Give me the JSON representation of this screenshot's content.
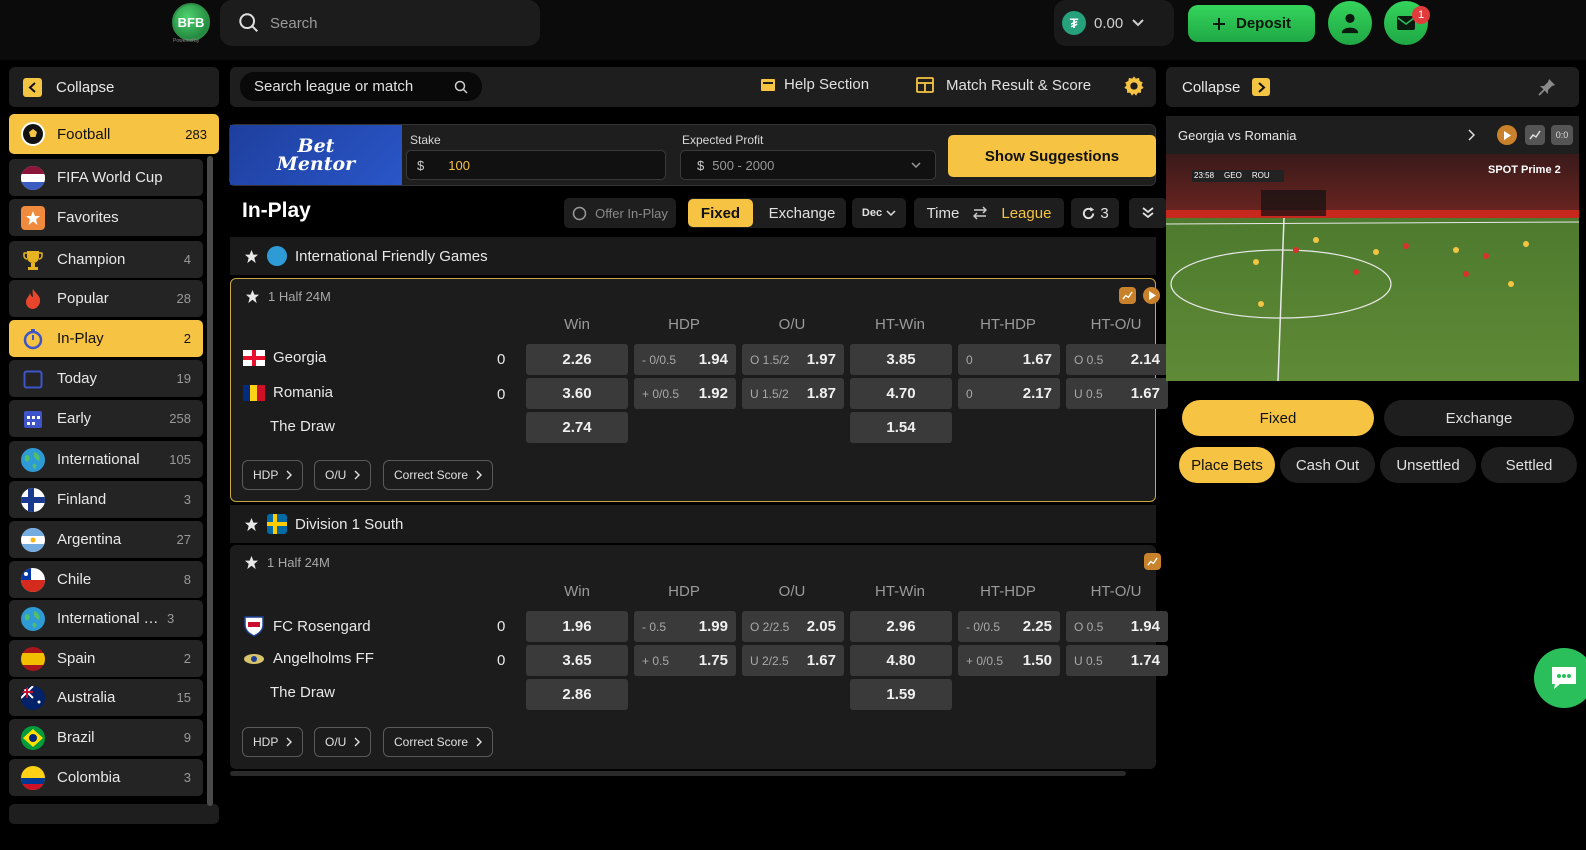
{
  "header": {
    "logo_text": "BFB",
    "logo_sub": "Powered by",
    "search_placeholder": "Search",
    "balance": "0.00",
    "deposit_label": "Deposit",
    "mail_badge": "1"
  },
  "sidebar": {
    "collapse_label": "Collapse",
    "items": [
      {
        "label": "Football",
        "count": "283"
      },
      {
        "label": "FIFA World Cup",
        "count": ""
      },
      {
        "label": "Favorites",
        "count": ""
      },
      {
        "label": "Champion",
        "count": "4"
      },
      {
        "label": "Popular",
        "count": "28"
      },
      {
        "label": "In-Play",
        "count": "2"
      },
      {
        "label": "Today",
        "count": "19"
      },
      {
        "label": "Early",
        "count": "258"
      },
      {
        "label": "International",
        "count": "105"
      },
      {
        "label": "Finland",
        "count": "3"
      },
      {
        "label": "Argentina",
        "count": "27"
      },
      {
        "label": "Chile",
        "count": "8"
      },
      {
        "label": "International Youth",
        "count": "3"
      },
      {
        "label": "Spain",
        "count": "2"
      },
      {
        "label": "Australia",
        "count": "15"
      },
      {
        "label": "Brazil",
        "count": "9"
      },
      {
        "label": "Colombia",
        "count": "3"
      }
    ]
  },
  "toolbar": {
    "league_search_placeholder": "Search league or match",
    "help_label": "Help Section",
    "match_result_label": "Match Result & Score"
  },
  "betmentor": {
    "logo_line1": "Bet",
    "logo_line2": "Mentor",
    "stake_label": "Stake",
    "stake_currency": "$",
    "stake_value": "100",
    "profit_label": "Expected Profit",
    "profit_currency": "$",
    "profit_value": "500 - 2000",
    "suggest_label": "Show Suggestions"
  },
  "inplay": {
    "title": "In-Play",
    "offer_label": "Offer In-Play",
    "fixed_label": "Fixed",
    "exchange_label": "Exchange",
    "odds_format": "Dec",
    "time_label": "Time",
    "league_label": "League",
    "refresh_count": "3"
  },
  "columns": [
    "Win",
    "HDP",
    "O/U",
    "HT-Win",
    "HT-HDP",
    "HT-O/U"
  ],
  "leagues": [
    {
      "name": "International Friendly Games",
      "match": {
        "time": "1 Half 24M",
        "home": {
          "name": "Georgia",
          "score": "0"
        },
        "away": {
          "name": "Romania",
          "score": "0"
        },
        "draw": "The Draw",
        "win": [
          "2.26",
          "3.60",
          "2.74"
        ],
        "hdp": [
          {
            "h": "- 0/0.5",
            "o": "1.94"
          },
          {
            "h": "+ 0/0.5",
            "o": "1.92"
          }
        ],
        "ou": [
          {
            "h": "O 1.5/2",
            "o": "1.97"
          },
          {
            "h": "U 1.5/2",
            "o": "1.87"
          }
        ],
        "htwin": [
          "3.85",
          "4.70",
          "1.54"
        ],
        "hthdp": [
          {
            "h": "0",
            "o": "1.67"
          },
          {
            "h": "0",
            "o": "2.17"
          }
        ],
        "htou": [
          {
            "h": "O 0.5",
            "o": "2.14"
          },
          {
            "h": "U 0.5",
            "o": "1.67"
          }
        ],
        "pills": [
          "HDP",
          "O/U",
          "Correct Score"
        ]
      }
    },
    {
      "name": "Division 1 South",
      "match": {
        "time": "1 Half 24M",
        "home": {
          "name": "FC Rosengard",
          "score": "0"
        },
        "away": {
          "name": "Angelholms FF",
          "score": "0"
        },
        "draw": "The Draw",
        "win": [
          "1.96",
          "3.65",
          "2.86"
        ],
        "hdp": [
          {
            "h": "- 0.5",
            "o": "1.99"
          },
          {
            "h": "+ 0.5",
            "o": "1.75"
          }
        ],
        "ou": [
          {
            "h": "O 2/2.5",
            "o": "2.05"
          },
          {
            "h": "U 2/2.5",
            "o": "1.67"
          }
        ],
        "htwin": [
          "2.96",
          "4.80",
          "1.59"
        ],
        "hthdp": [
          {
            "h": "- 0/0.5",
            "o": "2.25"
          },
          {
            "h": "+ 0/0.5",
            "o": "1.50"
          }
        ],
        "htou": [
          {
            "h": "O 0.5",
            "o": "1.94"
          },
          {
            "h": "U 0.5",
            "o": "1.74"
          }
        ],
        "pills": [
          "HDP",
          "O/U",
          "Correct Score"
        ]
      }
    }
  ],
  "right_panel": {
    "collapse_label": "Collapse",
    "video_title": "Georgia vs Romania",
    "scoreboard_time": "23:58",
    "scoreboard_home": "GEO",
    "scoreboard_away": "ROU",
    "broadcaster": "SPOT Prime 2",
    "fixed_label": "Fixed",
    "exchange_label": "Exchange",
    "tabs": [
      "Place Bets",
      "Cash Out",
      "Unsettled",
      "Settled"
    ]
  },
  "colors": {
    "accent_yellow": "#f6c343",
    "accent_green": "#2bbf5b",
    "odds_bg": "#3a3a3a"
  }
}
